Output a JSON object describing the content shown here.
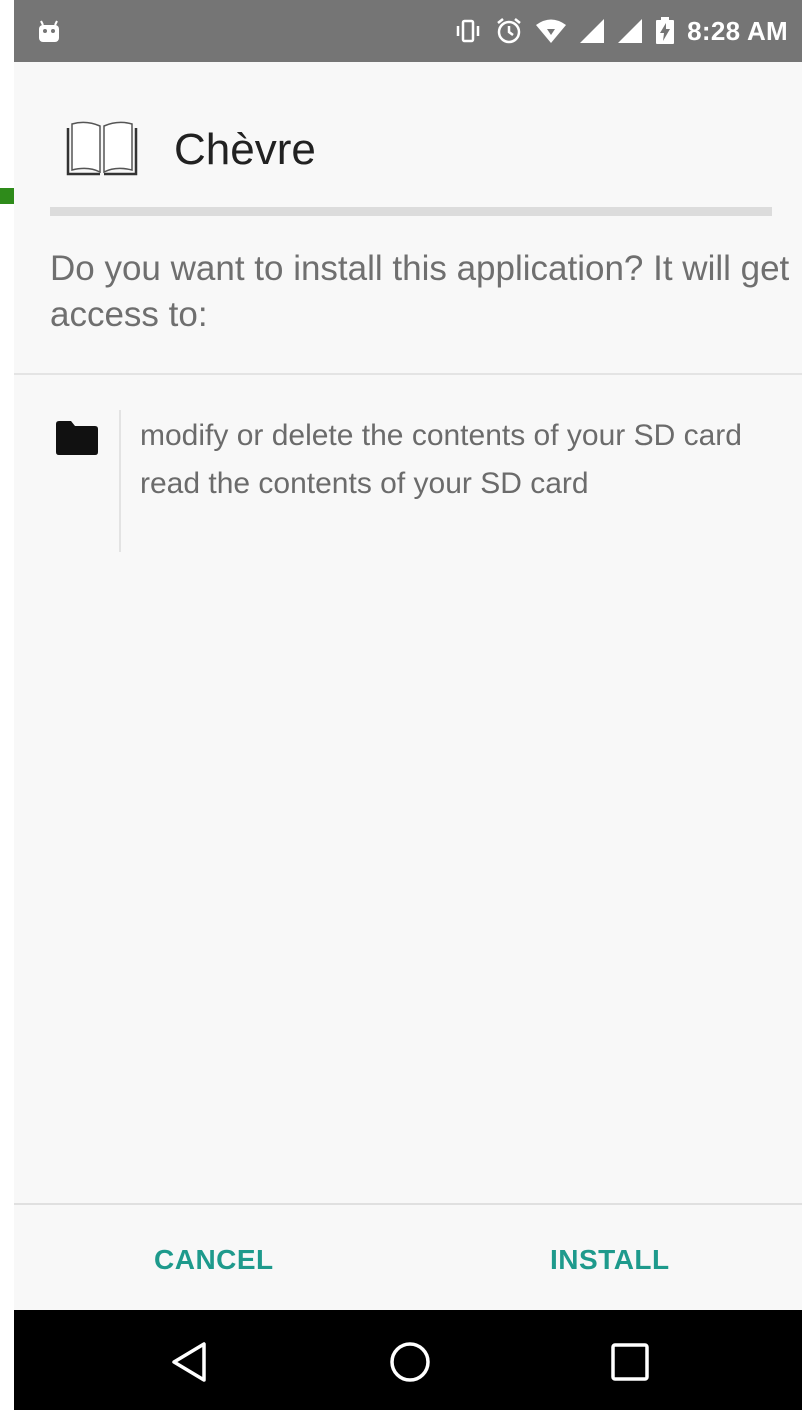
{
  "status_bar": {
    "time": "8:28 AM",
    "icons": [
      "android-icon",
      "vibrate-icon",
      "alarm-icon",
      "wifi-icon",
      "signal-icon",
      "signal-icon",
      "battery-charging-icon"
    ]
  },
  "app": {
    "name": "Chèvre",
    "icon": "open-book-icon"
  },
  "prompt": "Do you want to install this application? It will get access to:",
  "permissions": {
    "group_icon": "folder-icon",
    "items": [
      "modify or delete the contents of your SD card",
      "read the contents of your SD card"
    ]
  },
  "buttons": {
    "cancel_label": "CANCEL",
    "install_label": "INSTALL"
  },
  "navigation": [
    "back-icon",
    "home-icon",
    "recents-icon"
  ],
  "colors": {
    "status_bar": "#757575",
    "accent": "#1e9a8c",
    "background": "#f8f8f8",
    "nav_bar": "#000000"
  }
}
